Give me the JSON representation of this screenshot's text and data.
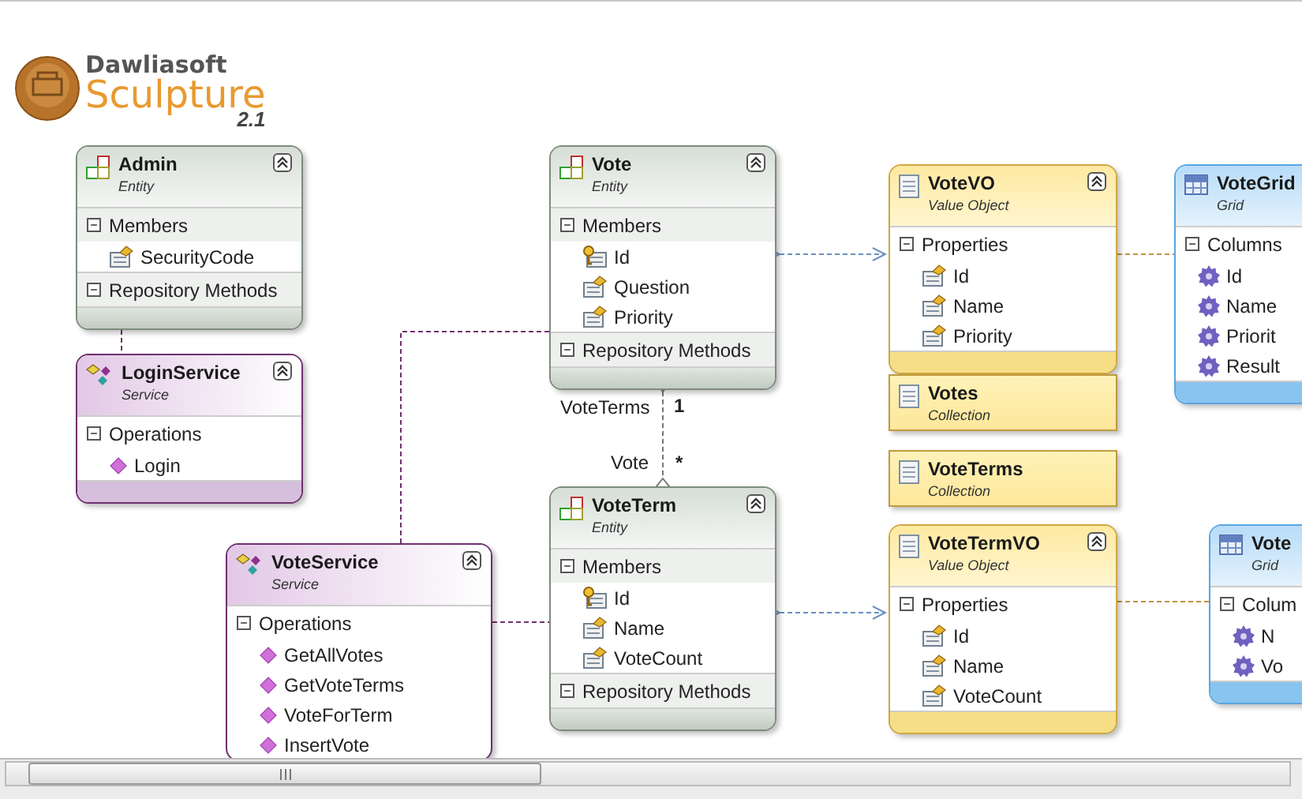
{
  "logo": {
    "brand": "Dawliasoft",
    "product": "Sculpture",
    "version": "2.1"
  },
  "nodes": [
    {
      "kind": "entity",
      "title": "Admin",
      "stereotype": "Entity",
      "sections": [
        {
          "title": "Members",
          "expanded": true,
          "items": [
            {
              "kind": "property",
              "text": "SecurityCode"
            }
          ]
        },
        {
          "title": "Repository Methods",
          "expanded": true
        }
      ]
    },
    {
      "kind": "service",
      "title": "LoginService",
      "stereotype": "Service",
      "sections": [
        {
          "title": "Operations",
          "expanded": true,
          "items": [
            {
              "kind": "operation",
              "text": "Login"
            }
          ]
        }
      ]
    },
    {
      "kind": "entity",
      "title": "Vote",
      "stereotype": "Entity",
      "sections": [
        {
          "title": "Members",
          "expanded": true,
          "items": [
            {
              "kind": "key",
              "text": "Id"
            },
            {
              "kind": "property",
              "text": "Question"
            },
            {
              "kind": "property",
              "text": "Priority"
            }
          ]
        },
        {
          "title": "Repository Methods",
          "expanded": true
        }
      ]
    },
    {
      "kind": "value_object",
      "title": "VoteVO",
      "stereotype": "Value Object",
      "sections": [
        {
          "title": "Properties",
          "expanded": true,
          "items": [
            {
              "kind": "property",
              "text": "Id"
            },
            {
              "kind": "property",
              "text": "Name"
            },
            {
              "kind": "property",
              "text": "Priority"
            }
          ]
        }
      ]
    },
    {
      "kind": "collection",
      "title": "Votes",
      "stereotype": "Collection"
    },
    {
      "kind": "collection",
      "title": "VoteTerms",
      "stereotype": "Collection"
    },
    {
      "kind": "grid",
      "title": "VoteGrid",
      "stereotype": "Grid",
      "sections": [
        {
          "title": "Columns",
          "expanded": true,
          "items": [
            {
              "kind": "column",
              "text": "Id"
            },
            {
              "kind": "column",
              "text": "Name"
            },
            {
              "kind": "column",
              "text": "Priorit"
            },
            {
              "kind": "column",
              "text": "Result"
            }
          ]
        }
      ]
    },
    {
      "kind": "entity",
      "title": "VoteTerm",
      "stereotype": "Entity",
      "sections": [
        {
          "title": "Members",
          "expanded": true,
          "items": [
            {
              "kind": "key",
              "text": "Id"
            },
            {
              "kind": "property",
              "text": "Name"
            },
            {
              "kind": "property",
              "text": "VoteCount"
            }
          ]
        },
        {
          "title": "Repository Methods",
          "expanded": true
        }
      ]
    },
    {
      "kind": "service",
      "title": "VoteService",
      "stereotype": "Service",
      "sections": [
        {
          "title": "Operations",
          "expanded": true,
          "items": [
            {
              "kind": "operation",
              "text": "GetAllVotes"
            },
            {
              "kind": "operation",
              "text": "GetVoteTerms"
            },
            {
              "kind": "operation",
              "text": "VoteForTerm"
            },
            {
              "kind": "operation",
              "text": "InsertVote"
            }
          ]
        }
      ]
    },
    {
      "kind": "value_object",
      "title": "VoteTermVO",
      "stereotype": "Value Object",
      "sections": [
        {
          "title": "Properties",
          "expanded": true,
          "items": [
            {
              "kind": "property",
              "text": "Id"
            },
            {
              "kind": "property",
              "text": "Name"
            },
            {
              "kind": "property",
              "text": "VoteCount"
            }
          ]
        }
      ]
    },
    {
      "kind": "grid",
      "title": "Vote",
      "stereotype": "Grid",
      "sections": [
        {
          "title": "Colum",
          "expanded": true,
          "items": [
            {
              "kind": "column",
              "text": "N"
            },
            {
              "kind": "column",
              "text": "Vo"
            }
          ]
        }
      ]
    }
  ],
  "association": {
    "source_role": "VoteTerms",
    "source_multiplicity": "1",
    "target_role": "Vote",
    "target_multiplicity": "*"
  }
}
